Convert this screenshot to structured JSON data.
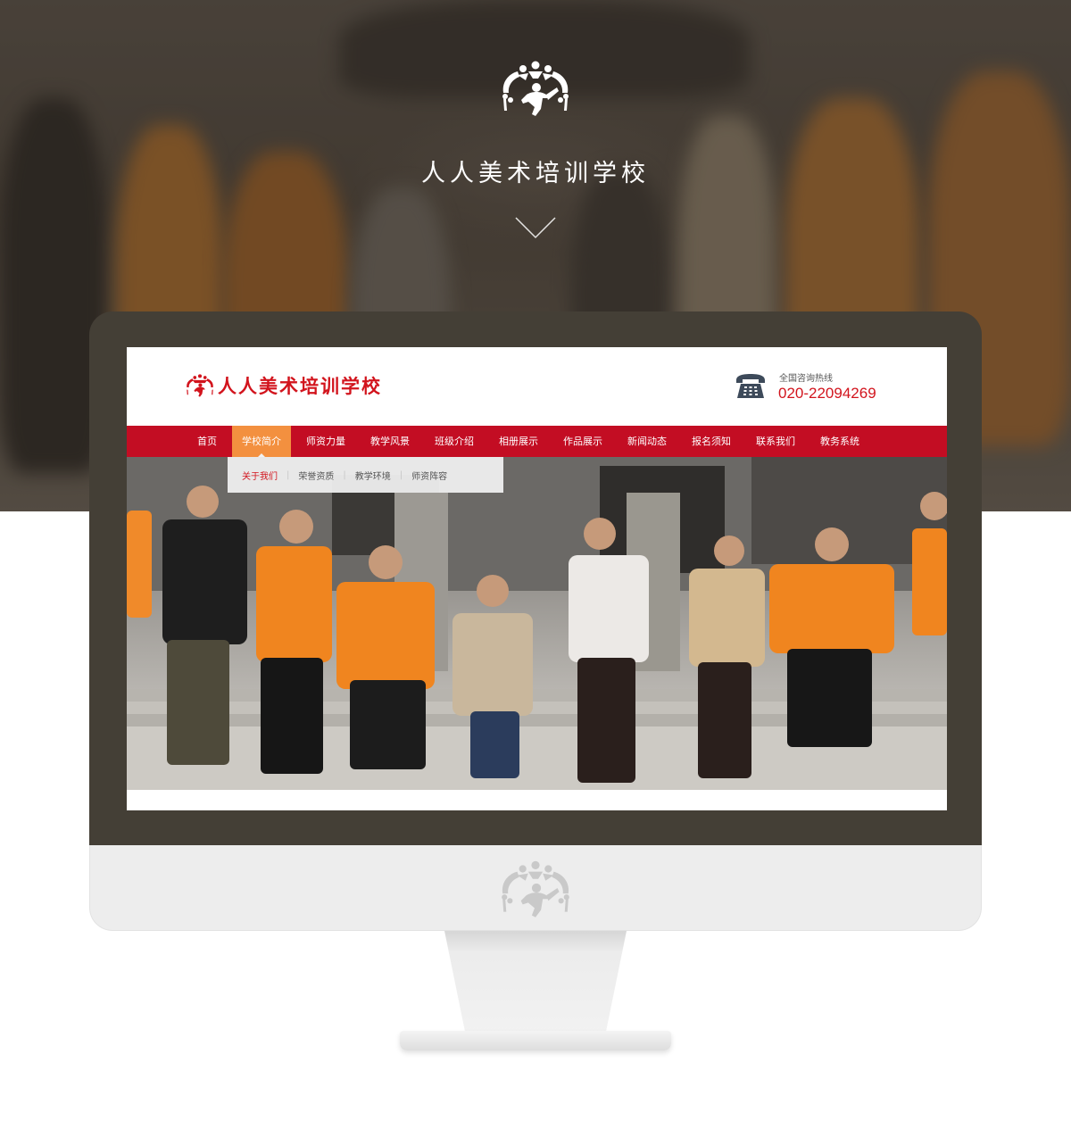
{
  "hero": {
    "title": "人人美术培训学校"
  },
  "site": {
    "name": "人人美术培训学校",
    "hotline_label": "全国咨询热线",
    "hotline_number": "020-22094269"
  },
  "nav": {
    "items": [
      {
        "label": "首页"
      },
      {
        "label": "学校简介"
      },
      {
        "label": "师资力量"
      },
      {
        "label": "教学风景"
      },
      {
        "label": "班级介绍"
      },
      {
        "label": "相册展示"
      },
      {
        "label": "作品展示"
      },
      {
        "label": "新闻动态"
      },
      {
        "label": "报名须知"
      },
      {
        "label": "联系我们"
      },
      {
        "label": "教务系统"
      }
    ],
    "active_index": 1
  },
  "submenu": {
    "items": [
      {
        "label": "关于我们"
      },
      {
        "label": "荣誉资质"
      },
      {
        "label": "教学环境"
      },
      {
        "label": "师资阵容"
      }
    ],
    "active_index": 0
  },
  "colors": {
    "brand_red": "#c30d23",
    "nav_active": "#f3903f",
    "monitor_frame": "#443f36"
  },
  "icons": [
    "school-logo-icon",
    "chevron-down-icon",
    "telephone-icon"
  ]
}
